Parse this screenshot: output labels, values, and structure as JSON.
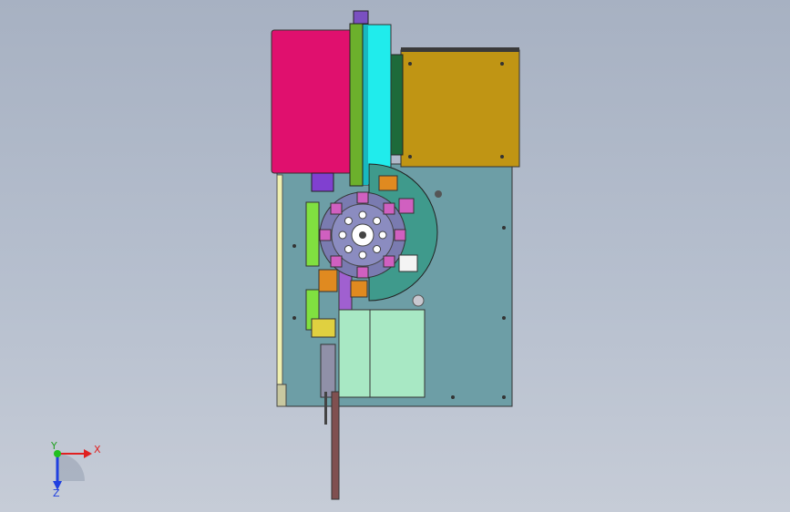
{
  "viewport": {
    "background_top": "#a7b1c2",
    "background_bottom": "#c6ccd7"
  },
  "model": {
    "colors": {
      "base_plate": "#6d9ea6",
      "magenta_block": "#e0106e",
      "gold_block": "#c09514",
      "cyan_rail": "#20ecec",
      "green_rail": "#6cb02c",
      "mint_box": "#a8e8c4",
      "teal_disc": "#3f9a8c",
      "dial": "#7a7bb0",
      "pink_parts": "#d060c0",
      "orange_parts": "#e08a20",
      "yellow_strip": "#f0f0b0",
      "brown_arm": "#805050"
    },
    "dial_stations": 8
  },
  "triad": {
    "x_label": "X",
    "y_label": "Y",
    "z_label": "Z",
    "x_color": "#e02020",
    "y_color": "#20c020",
    "z_color": "#2040e0"
  }
}
